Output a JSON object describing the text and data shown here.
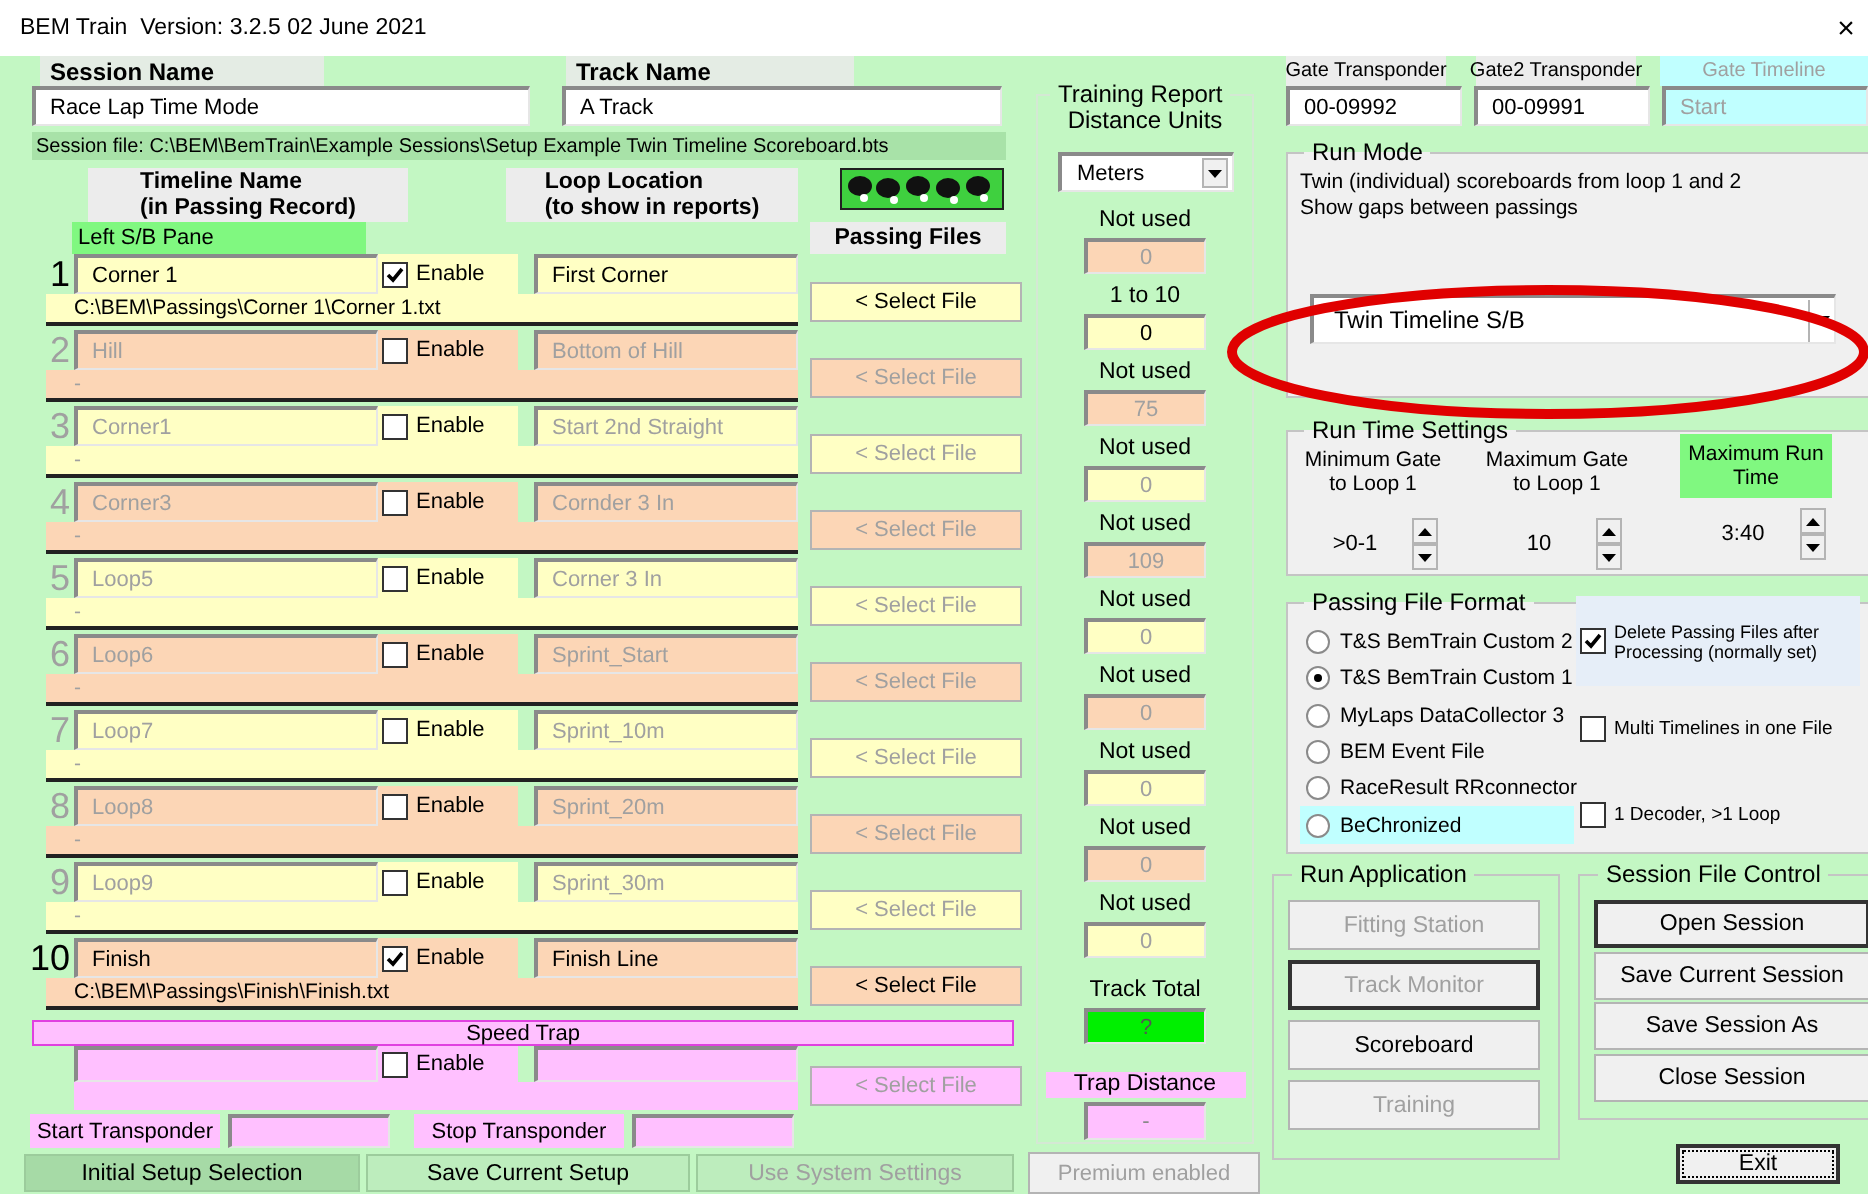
{
  "window": {
    "title": "BEM Train  Version: 3.2.5 02 June 2021",
    "close": "×"
  },
  "session": {
    "session_name_label": "Session Name",
    "session_name": "Race Lap Time Mode",
    "track_name_label": "Track Name",
    "track_name": "A Track",
    "session_file": "Session file: C:\\BEM\\BemTrain\\Example Sessions\\Setup Example Twin Timeline Scoreboard.bts"
  },
  "timeline": {
    "name_header": [
      "Timeline Name",
      "(in Passing Record)"
    ],
    "location_header": [
      "Loop Location",
      "(to show in reports)"
    ],
    "pane_label": "Left S/B Pane",
    "passing_files_header": "Passing Files",
    "rows": [
      {
        "number": "1",
        "name": "Corner 1",
        "enable_label": "Enable",
        "enabled": true,
        "location": "First Corner",
        "path": "C:\\BEM\\Passings\\Corner 1\\Corner 1.txt",
        "button": "< Select File"
      },
      {
        "number": "2",
        "name": "Hill",
        "enable_label": "Enable",
        "enabled": false,
        "location": "Bottom of Hill",
        "path": "-",
        "button": "< Select File"
      },
      {
        "number": "3",
        "name": "Corner1",
        "enable_label": "Enable",
        "enabled": false,
        "location": "Start 2nd Straight",
        "path": "-",
        "button": "< Select File"
      },
      {
        "number": "4",
        "name": "Corner3",
        "enable_label": "Enable",
        "enabled": false,
        "location": "Cornder 3 In",
        "path": "-",
        "button": "< Select File"
      },
      {
        "number": "5",
        "name": "Loop5",
        "enable_label": "Enable",
        "enabled": false,
        "location": "Corner 3 In",
        "path": "-",
        "button": "< Select File"
      },
      {
        "number": "6",
        "name": "Loop6",
        "enable_label": "Enable",
        "enabled": false,
        "location": "Sprint_Start",
        "path": "-",
        "button": "< Select File"
      },
      {
        "number": "7",
        "name": "Loop7",
        "enable_label": "Enable",
        "enabled": false,
        "location": "Sprint_10m",
        "path": "-",
        "button": "< Select File"
      },
      {
        "number": "8",
        "name": "Loop8",
        "enable_label": "Enable",
        "enabled": false,
        "location": "Sprint_20m",
        "path": "-",
        "button": "< Select File"
      },
      {
        "number": "9",
        "name": "Loop9",
        "enable_label": "Enable",
        "enabled": false,
        "location": "Sprint_30m",
        "path": "-",
        "button": "< Select File"
      },
      {
        "number": "10",
        "name": "Finish",
        "enable_label": "Enable",
        "enabled": true,
        "location": "Finish Line",
        "path": "C:\\BEM\\Passings\\Finish\\Finish.txt",
        "button": "< Select File"
      }
    ]
  },
  "speed_trap": {
    "title": "Speed Trap",
    "enable_label": "Enable",
    "enabled": false,
    "button": "< Select File",
    "start_label": "Start Transponder",
    "stop_label": "Stop Transponder"
  },
  "bottom_buttons": [
    {
      "label": "Initial Setup Selection",
      "selected": true,
      "disabled": false
    },
    {
      "label": "Save Current Setup",
      "selected": false,
      "disabled": false
    },
    {
      "label": "Use System Settings",
      "selected": false,
      "disabled": true
    }
  ],
  "distances": {
    "title": "Training Report",
    "subtitle": "Distance Units",
    "units": "Meters",
    "entries": [
      {
        "label": "Not used",
        "value": "0",
        "active": false
      },
      {
        "label": "1 to 10",
        "value": "0",
        "active": true
      },
      {
        "label": "Not used",
        "value": "75",
        "active": false
      },
      {
        "label": "Not used",
        "value": "0",
        "active": false
      },
      {
        "label": "Not used",
        "value": "109",
        "active": false
      },
      {
        "label": "Not used",
        "value": "0",
        "active": false
      },
      {
        "label": "Not used",
        "value": "0",
        "active": false
      },
      {
        "label": "Not used",
        "value": "0",
        "active": false
      },
      {
        "label": "Not used",
        "value": "0",
        "active": false
      },
      {
        "label": "Not used",
        "value": "0",
        "active": false
      }
    ],
    "total_label": "Track Total",
    "total": "?",
    "trap_label": "Trap Distance",
    "trap": "-"
  },
  "premium_button": {
    "label": "Premium enabled",
    "disabled": true
  },
  "transponders": [
    {
      "label": "Gate Transponder",
      "value": "00-09992",
      "disabled": false
    },
    {
      "label": "Gate2 Transponder",
      "value": "00-09991",
      "disabled": false
    },
    {
      "label": "Gate Timeline",
      "value": "Start",
      "disabled": true
    }
  ],
  "run_mode": {
    "title": "Run Mode",
    "description": [
      "Twin (individual) scoreboards from loop 1 and 2",
      "Show gaps between passings"
    ],
    "mode": "Twin Timeline S/B",
    "highlighted": true
  },
  "run_time": {
    "title": "Run Time Settings",
    "settings": [
      {
        "label": "Minimum Gate to Loop 1",
        "value": ">0-1",
        "highlighted": false
      },
      {
        "label": "Maximum Gate to Loop 1",
        "value": "10",
        "highlighted": false
      },
      {
        "label": "Maximum Run Time",
        "value": "3:40",
        "highlighted": true
      }
    ]
  },
  "passing_format": {
    "title": "Passing File Format",
    "formats": [
      {
        "label": "T&S BemTrain Custom 2",
        "selected": false,
        "highlighted": false
      },
      {
        "label": "T&S BemTrain Custom 1",
        "selected": true,
        "highlighted": false
      },
      {
        "label": "MyLaps DataCollector 3",
        "selected": false,
        "highlighted": false
      },
      {
        "label": "BEM Event File",
        "selected": false,
        "highlighted": false
      },
      {
        "label": "RaceResult RRconnector",
        "selected": false,
        "highlighted": false
      },
      {
        "label": "BeChronized",
        "selected": false,
        "highlighted": true
      }
    ],
    "options": [
      {
        "label": "Delete Passing Files after Processing (normally set)",
        "checked": true,
        "highlighted": true
      },
      {
        "label": "Multi Timelines in one File",
        "checked": false,
        "highlighted": false
      },
      {
        "label": "1 Decoder, >1 Loop",
        "checked": false,
        "highlighted": false
      }
    ]
  },
  "run_application": {
    "title": "Run Application",
    "buttons": [
      {
        "label": "Fitting Station",
        "disabled": true,
        "focused": false
      },
      {
        "label": "Track Monitor",
        "disabled": true,
        "focused": true
      },
      {
        "label": "Scoreboard",
        "disabled": false,
        "focused": false
      },
      {
        "label": "Training",
        "disabled": true,
        "focused": false
      }
    ]
  },
  "session_control": {
    "title": "Session File Control",
    "buttons": [
      {
        "label": "Open Session",
        "disabled": false,
        "focused": true
      },
      {
        "label": "Save Current Session",
        "disabled": false,
        "focused": false
      },
      {
        "label": "Save Session As",
        "disabled": false,
        "focused": false
      },
      {
        "label": "Close Session",
        "disabled": false,
        "focused": false
      }
    ]
  },
  "exit_button": {
    "label": "Exit",
    "focused": true
  }
}
